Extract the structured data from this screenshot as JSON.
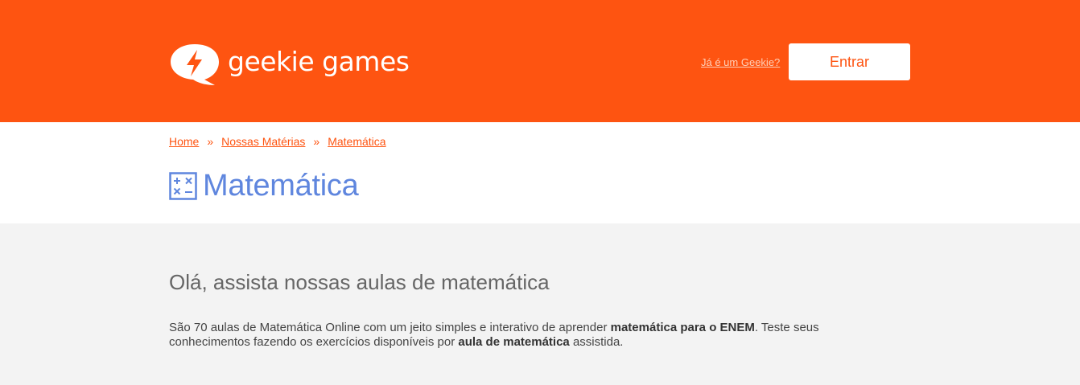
{
  "header": {
    "brand_name": "geekie games",
    "login_link": "Já é um Geekie?",
    "enter_button": "Entrar"
  },
  "breadcrumb": {
    "items": [
      "Home",
      "Nossas Matérias",
      "Matemática"
    ],
    "separator": "»"
  },
  "page": {
    "title": "Matemática",
    "icon": "math-symbols-icon"
  },
  "intro": {
    "heading": "Olá, assista nossas aulas de matemática",
    "paragraph_part1": "São 70 aulas de Matemática Online com um jeito simples e interativo de aprender ",
    "paragraph_bold1": "matemática para o ENEM",
    "paragraph_part2": ". Teste seus conhecimentos fazendo os exercícios disponíveis por ",
    "paragraph_bold2": "aula de matemática",
    "paragraph_part3": " assistida."
  },
  "colors": {
    "brand_orange": "#fe5411",
    "title_blue": "#5f86de",
    "content_bg": "#f3f3f3"
  }
}
